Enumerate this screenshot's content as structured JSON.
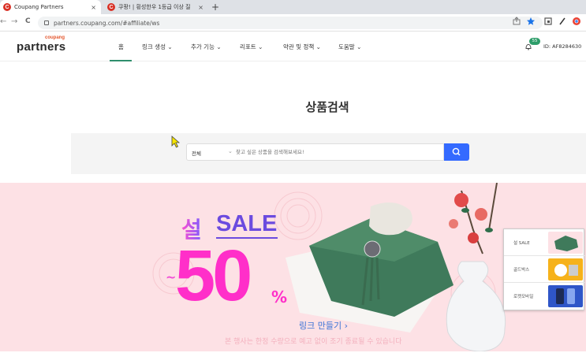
{
  "browser": {
    "tabs": [
      {
        "title": "Coupang Partners",
        "favicon": "C",
        "active": true
      },
      {
        "title": "쿠팡! | 횡성한우 1등급 이상 질",
        "favicon": "C",
        "active": false
      }
    ],
    "close_glyph": "×",
    "new_tab_glyph": "+",
    "back_glyph": "←",
    "forward_glyph": "→",
    "reload_glyph": "C",
    "url": "partners.coupang.com/#affiliate/ws"
  },
  "header": {
    "logo_small": "coupang",
    "logo_big": "partners",
    "nav": [
      {
        "label": "홈",
        "has_dropdown": false,
        "active": true
      },
      {
        "label": "링크 생성",
        "has_dropdown": true
      },
      {
        "label": "추가 기능",
        "has_dropdown": true
      },
      {
        "label": "리포트",
        "has_dropdown": true
      },
      {
        "label": "약관 및 정책",
        "has_dropdown": true
      },
      {
        "label": "도움말",
        "has_dropdown": true
      }
    ],
    "notification_count": "55",
    "user_id": "ID: AF8284630",
    "accent_color": "#2f8f6d"
  },
  "main": {
    "title": "상품검색",
    "search": {
      "category": "전체",
      "placeholder": "찾고 싶은 상품을 검색해보세요!",
      "button_icon": "search-icon",
      "button_color": "#346aff"
    }
  },
  "banner": {
    "seol": "설",
    "sale": "SALE",
    "tilde": "~",
    "percent_value": "50",
    "percent_sign": "%",
    "link_label": "링크 만들기",
    "notice": "본 행사는 한정 수량으로 예고 없이 조기 종료될 수 있습니다",
    "thumbnails": [
      {
        "label": "설 SALE"
      },
      {
        "label": "골드박스"
      },
      {
        "label": "로켓모바일"
      }
    ]
  }
}
